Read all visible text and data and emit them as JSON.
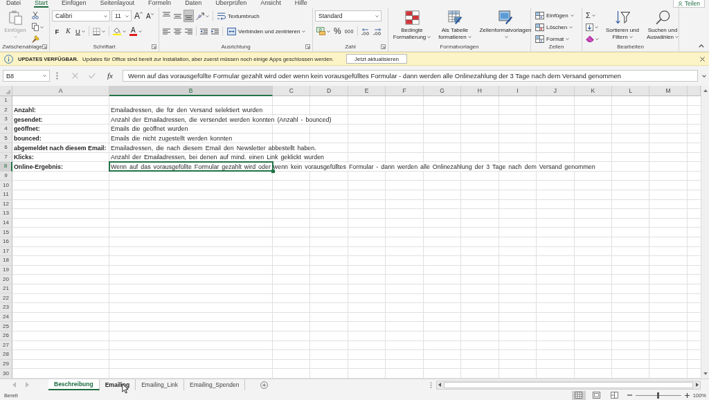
{
  "ribbon_tabs": [
    {
      "label": "Datei",
      "selected": false
    },
    {
      "label": "Start",
      "selected": true
    },
    {
      "label": "Einfügen",
      "selected": false
    },
    {
      "label": "Seitenlayout",
      "selected": false
    },
    {
      "label": "Formeln",
      "selected": false
    },
    {
      "label": "Daten",
      "selected": false
    },
    {
      "label": "Überprüfen",
      "selected": false
    },
    {
      "label": "Ansicht",
      "selected": false
    },
    {
      "label": "Hilfe",
      "selected": false
    }
  ],
  "share_button": {
    "label": "Teilen"
  },
  "ribbon_groups": [
    {
      "kind": "clipboard",
      "label": "Zwischenablage",
      "launcher": true,
      "paste_button": {
        "label": "Einfügen",
        "disabled": true
      }
    },
    {
      "kind": "font",
      "label": "Schriftart",
      "launcher": true,
      "font_name": "Calibri",
      "font_size": "11",
      "size_buttons": [
        "A",
        "A"
      ],
      "style_buttons": [
        "F",
        "K",
        "U"
      ],
      "font_color_button": "A"
    },
    {
      "kind": "alignment",
      "label": "Ausrichtung",
      "launcher": true,
      "vertical_align": [
        {
          "selected": false
        },
        {
          "selected": false
        },
        {
          "selected": true
        }
      ],
      "horizontal_align": [
        {
          "selected": false
        },
        {
          "selected": false
        },
        {
          "selected": false
        }
      ],
      "wrap_button": "Textumbruch",
      "merge_button": "Verbinden und zentrieren"
    },
    {
      "kind": "number",
      "label": "Zahl",
      "launcher": true,
      "format": "Standard",
      "percent_button": "%",
      "thousands_button": "000"
    },
    {
      "kind": "styles",
      "label": "Formatvorlagen",
      "launcher": false,
      "buttons": [
        "Bedingte Formatierung",
        "Als Tabelle formatieren",
        "Zellenformatvorlagen"
      ]
    },
    {
      "kind": "cells",
      "label": "Zellen",
      "launcher": false,
      "buttons": [
        "Einfügen",
        "Löschen",
        "Format"
      ]
    },
    {
      "kind": "editing",
      "label": "Bearbeiten",
      "launcher": false,
      "sum_button": "Σ",
      "buttons": [
        "Sortieren und Filtern",
        "Suchen und Auswählen"
      ]
    }
  ],
  "update_bar": {
    "title": "UPDATES VERFÜGBAR.",
    "message": "Updates für Office sind bereit zur Installation, aber zuerst müssen noch einige Apps geschlossen werden.",
    "button": "Jetzt aktualisieren"
  },
  "formula_bar": {
    "name_box": "B8",
    "edit_buttons": [
      {
        "kind": "cancel",
        "disabled": true
      },
      {
        "kind": "enter",
        "disabled": true
      }
    ],
    "function_button": "fx",
    "formula": "Wenn auf das vorausgefüllte Formular gezahlt wird oder wenn kein vorausgefülltes Formular - dann werden alle Onlinezahlung der 3 Tage nach dem Versand genommen"
  },
  "sheet": {
    "columns": [
      {
        "label": "A",
        "selected": false
      },
      {
        "label": "B",
        "selected": true
      },
      {
        "label": "C",
        "selected": false
      },
      {
        "label": "D",
        "selected": false
      },
      {
        "label": "E",
        "selected": false
      },
      {
        "label": "F",
        "selected": false
      },
      {
        "label": "G",
        "selected": false
      },
      {
        "label": "H",
        "selected": false
      },
      {
        "label": "I",
        "selected": false
      },
      {
        "label": "J",
        "selected": false
      },
      {
        "label": "K",
        "selected": false
      },
      {
        "label": "L",
        "selected": false
      },
      {
        "label": "M",
        "selected": false
      }
    ],
    "rows": [
      {
        "number": "1",
        "selected": false
      },
      {
        "number": "2",
        "selected": false,
        "cells": [
          {
            "text": "Anzahl:",
            "bold": true,
            "selected": false
          },
          {
            "text": "Emailadressen, die für den Versand selektiert wurden",
            "bold": false,
            "selected": false
          }
        ]
      },
      {
        "number": "3",
        "selected": false,
        "cells": [
          {
            "text": "gesendet:",
            "bold": true,
            "selected": false
          },
          {
            "text": "Anzahl der Emailadressen, die versendet werden konnten (Anzahl - bounced)",
            "bold": false,
            "selected": false
          }
        ]
      },
      {
        "number": "4",
        "selected": false,
        "cells": [
          {
            "text": "geöffnet:",
            "bold": true,
            "selected": false
          },
          {
            "text": "Emails die geöffnet wurden",
            "bold": false,
            "selected": false
          }
        ]
      },
      {
        "number": "5",
        "selected": false,
        "cells": [
          {
            "text": "bounced:",
            "bold": true,
            "selected": false
          },
          {
            "text": "Emails die nicht zugestellt werden konnten",
            "bold": false,
            "selected": false
          }
        ]
      },
      {
        "number": "6",
        "selected": false,
        "cells": [
          {
            "text": "abgemeldet nach diesem Email:",
            "bold": true,
            "selected": false
          },
          {
            "text": "Emailadressen, die nach diesem Email den Newsletter abbestellt haben.",
            "bold": false,
            "selected": false
          }
        ]
      },
      {
        "number": "7",
        "selected": false,
        "cells": [
          {
            "text": "Klicks:",
            "bold": true,
            "selected": false
          },
          {
            "text": "Anzahl der Emailadressen, bei denen auf mind. einen Link geklickt wurden",
            "bold": false,
            "selected": false
          }
        ]
      },
      {
        "number": "8",
        "selected": true,
        "cells": [
          {
            "text": "Online-Ergebnis:",
            "bold": true,
            "selected": false
          },
          {
            "text": "Wenn auf das vorausgefüllte Formular gezahlt wird oder wenn kein vorausgefülltes Formular - dann werden alle Onlinezahlung der 3 Tage nach dem Versand genommen",
            "bold": false,
            "selected": true
          }
        ]
      },
      {
        "number": "9",
        "selected": false
      },
      {
        "number": "10",
        "selected": false
      },
      {
        "number": "11",
        "selected": false
      },
      {
        "number": "12",
        "selected": false
      },
      {
        "number": "13",
        "selected": false
      },
      {
        "number": "14",
        "selected": false
      },
      {
        "number": "15",
        "selected": false
      },
      {
        "number": "16",
        "selected": false
      },
      {
        "number": "17",
        "selected": false
      },
      {
        "number": "18",
        "selected": false
      },
      {
        "number": "19",
        "selected": false
      },
      {
        "number": "20",
        "selected": false
      },
      {
        "number": "21",
        "selected": false
      },
      {
        "number": "22",
        "selected": false
      },
      {
        "number": "23",
        "selected": false
      },
      {
        "number": "24",
        "selected": false
      },
      {
        "number": "25",
        "selected": false
      },
      {
        "number": "26",
        "selected": false
      },
      {
        "number": "27",
        "selected": false
      },
      {
        "number": "28",
        "selected": false
      },
      {
        "number": "29",
        "selected": false
      },
      {
        "number": "30",
        "selected": false
      }
    ]
  },
  "sheet_nav": [
    {
      "disabled": true
    },
    {
      "disabled": true
    }
  ],
  "sheet_tabs": [
    {
      "label": "Beschreibung",
      "selected": true,
      "hovered": false
    },
    {
      "label": "Emailing",
      "selected": false,
      "hovered": true
    },
    {
      "label": "Emailing_Link",
      "selected": false,
      "hovered": false
    },
    {
      "label": "Emailing_Spenden",
      "selected": false,
      "hovered": false
    }
  ],
  "status_bar": {
    "status": "Bereit",
    "views": [
      {
        "selected": true
      },
      {
        "selected": false
      },
      {
        "selected": false
      }
    ],
    "zoom_slider": {
      "level": 0.5
    },
    "zoom": "100%"
  }
}
